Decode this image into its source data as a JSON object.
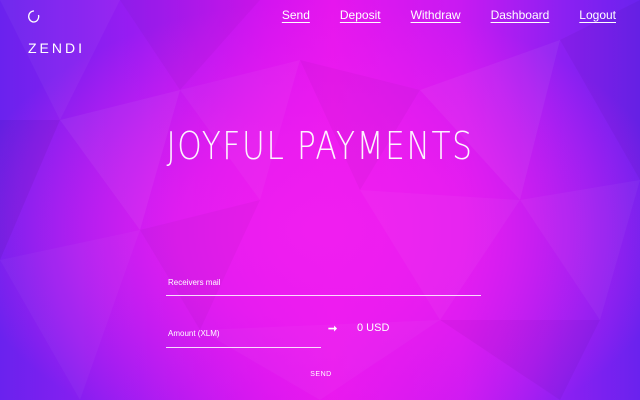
{
  "brand": {
    "name": "ZENDI",
    "logo_icon": "ring-logo-icon"
  },
  "nav": {
    "items": [
      {
        "label": "Send"
      },
      {
        "label": "Deposit"
      },
      {
        "label": "Withdraw"
      },
      {
        "label": "Dashboard"
      },
      {
        "label": "Logout"
      }
    ]
  },
  "hero": {
    "title": "JOYFUL PAYMENTS"
  },
  "form": {
    "receiver_placeholder": "Receivers mail",
    "amount_placeholder": "Amount (XLM)",
    "arrow_glyph": "➞",
    "converted_value": "0 USD",
    "send_label": "SEND"
  },
  "colors": {
    "background_left": "#6a22ee",
    "background_center": "#e616ee",
    "text": "#ffffff"
  }
}
